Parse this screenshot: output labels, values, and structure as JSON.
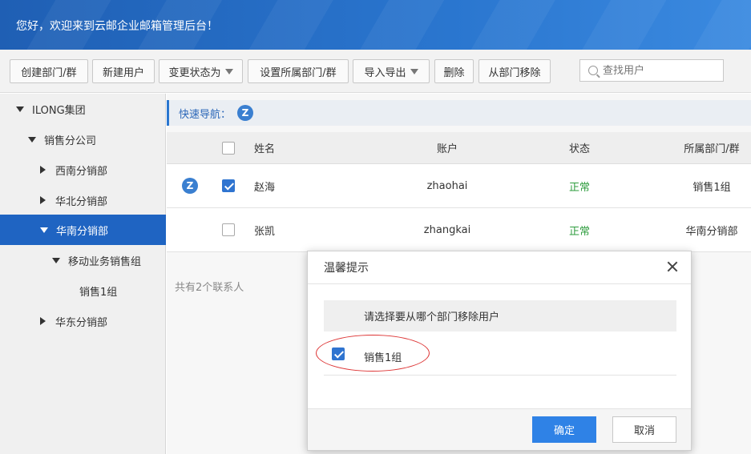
{
  "header": {
    "title": "您好，欢迎来到云邮企业邮箱管理后台！"
  },
  "toolbar": {
    "create_dept": "创建部门/群",
    "new_user": "新建用户",
    "change_status": "变更状态为",
    "set_dept": "设置所属部门/群",
    "import_export": "导入导出",
    "delete": "删除",
    "remove_from_dept": "从部门移除",
    "search_placeholder": "查找用户"
  },
  "sidebar": {
    "items": [
      {
        "label": "ILONG集团",
        "expand": "down",
        "active": false
      },
      {
        "label": "销售分公司",
        "expand": "down",
        "active": false
      },
      {
        "label": "西南分销部",
        "expand": "right",
        "active": false
      },
      {
        "label": "华北分销部",
        "expand": "right",
        "active": false
      },
      {
        "label": "华南分销部",
        "expand": "down",
        "active": true
      },
      {
        "label": "移动业务销售组",
        "expand": "down",
        "active": false
      },
      {
        "label": "销售1组",
        "expand": "none",
        "active": false
      },
      {
        "label": "华东分销部",
        "expand": "right",
        "active": false
      }
    ]
  },
  "quicknav": {
    "label": "快速导航：",
    "badge": "Z"
  },
  "table": {
    "headers": {
      "name": "姓名",
      "account": "账户",
      "status": "状态",
      "dept": "所属部门/群"
    },
    "rows": [
      {
        "badge": "Z",
        "checked": true,
        "name": "赵海",
        "account": "zhaohai",
        "status": "正常",
        "dept": "销售1组"
      },
      {
        "badge": "",
        "checked": false,
        "name": "张凯",
        "account": "zhangkai",
        "status": "正常",
        "dept": "华南分销部"
      }
    ],
    "count_text": "共有2个联系人"
  },
  "modal": {
    "title": "温馨提示",
    "prompt": "请选择要从哪个部门移除用户",
    "option_label": "销售1组",
    "option_checked": true,
    "ok": "确定",
    "cancel": "取消"
  },
  "colors": {
    "brand": "#2a76cf",
    "active": "#1f64c2",
    "status_ok": "#2e9c3e",
    "ok_button": "#2f82e6",
    "annotation": "#dd3333"
  }
}
